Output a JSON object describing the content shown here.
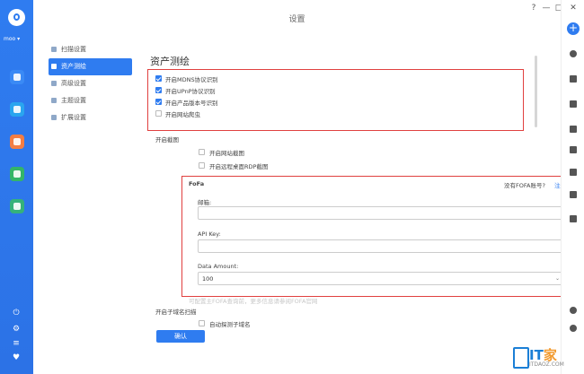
{
  "app": {
    "user": "moo",
    "window_title": "设置",
    "controls": [
      "?",
      "—",
      "□",
      "✕"
    ]
  },
  "settings_nav": [
    {
      "label": "扫描设置",
      "icon": "scan-icon",
      "active": false
    },
    {
      "label": "资产测绘",
      "icon": "map-icon",
      "active": true
    },
    {
      "label": "高级设置",
      "icon": "gear-icon",
      "active": false
    },
    {
      "label": "主题设置",
      "icon": "theme-icon",
      "active": false
    },
    {
      "label": "扩展设置",
      "icon": "puzzle-icon",
      "active": false
    }
  ],
  "content": {
    "heading": "资产测绘",
    "options": [
      {
        "label": "开启MDNS协议识别",
        "checked": true
      },
      {
        "label": "开启UPnP协议识别",
        "checked": true
      },
      {
        "label": "开启产品版本号识别",
        "checked": true
      },
      {
        "label": "开启网站爬虫",
        "checked": false
      }
    ],
    "screenshot": {
      "title": "开启截图",
      "options": [
        {
          "label": "开启网站截图",
          "checked": false
        },
        {
          "label": "开启远程桌面RDP截图",
          "checked": false
        }
      ]
    },
    "fofa": {
      "title": "FoFa",
      "no_account": "没有FOFA账号?",
      "register": "注册",
      "email_label": "邮箱:",
      "email_value": "",
      "apikey_label": "API Key:",
      "apikey_value": "",
      "amount_label": "Data Amount:",
      "amount_value": "100",
      "hint": "可配置主FOFA查询前，更多信息请参阅FOFA官网"
    },
    "subdomain": {
      "title": "开启子域名扫描",
      "option": "自动探测子域名"
    },
    "confirm": "确认"
  },
  "colors": {
    "accent": "#2f7cf0",
    "highlight": "#e0403f"
  },
  "watermark": {
    "brand": "IT",
    "brand2": "家",
    "site": "ITDAOZ.COM"
  }
}
